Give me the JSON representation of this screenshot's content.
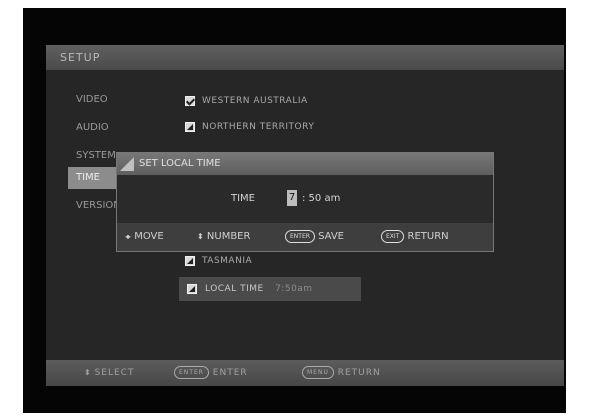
{
  "setup": {
    "title": "SETUP",
    "sidebar": [
      {
        "label": "VIDEO"
      },
      {
        "label": "AUDIO"
      },
      {
        "label": "SYSTEM"
      },
      {
        "label": "TIME"
      },
      {
        "label": "VERSION"
      }
    ],
    "regions": [
      {
        "label": "WESTERN AUSTRALIA",
        "state": "checked"
      },
      {
        "label": "NORTHERN TERRITORY",
        "state": "filled"
      },
      {
        "label": "TASMANIA",
        "state": "filled"
      }
    ],
    "local_time": {
      "label": "LOCAL TIME",
      "value": "7:50am"
    }
  },
  "dialog": {
    "title": "SET LOCAL TIME",
    "time_label": "TIME",
    "hour": "7",
    "rest": ": 50 am",
    "footer": {
      "move_icon": "◂▸",
      "move": "MOVE",
      "number_icon": "⬍",
      "number": "NUMBER",
      "enter_key": "ENTER",
      "save": "SAVE",
      "exit_key": "EXIT",
      "return": "RETURN"
    }
  },
  "bottom_bar": {
    "select_icon": "⬍",
    "select": "SELECT",
    "enter_key": "ENTER",
    "enter": "ENTER",
    "menu_key": "MENU",
    "return": "RETURN"
  }
}
